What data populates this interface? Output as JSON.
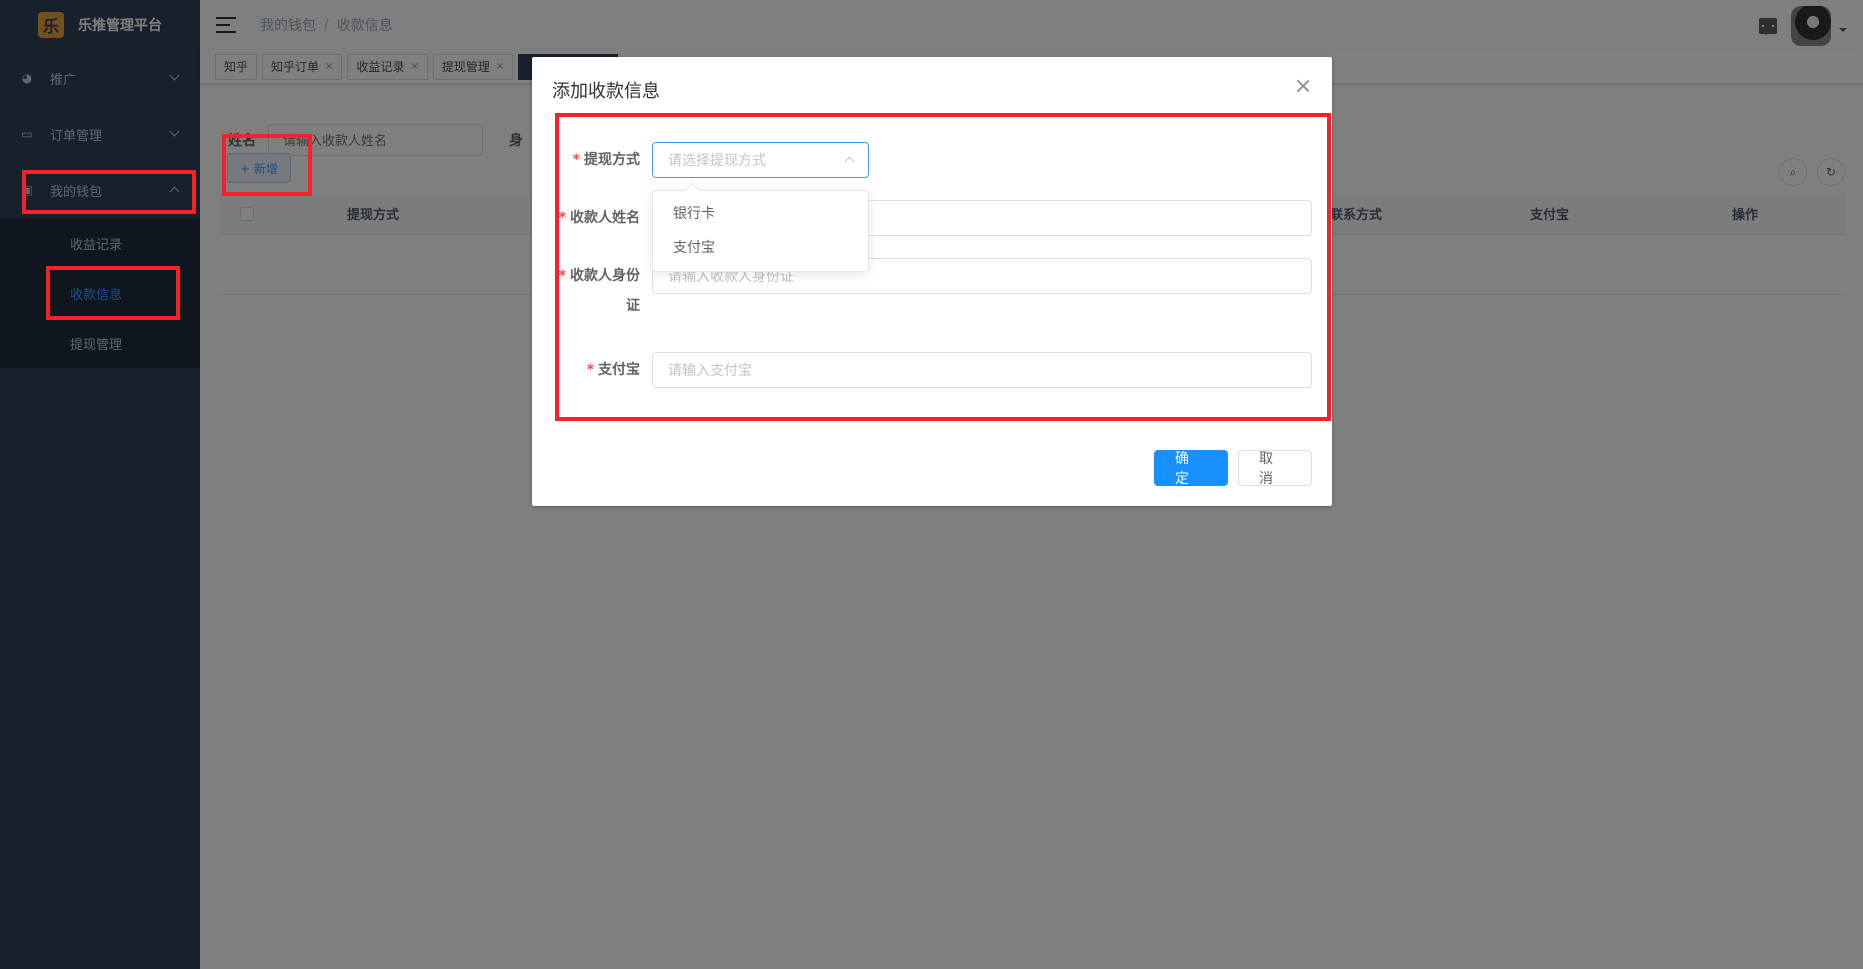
{
  "app": {
    "title": "乐推管理平台",
    "logo_glyph": "乐"
  },
  "sidebar": {
    "items": [
      {
        "label": "推广",
        "icon": "globe-icon"
      },
      {
        "label": "订单管理",
        "icon": "monitor-icon"
      },
      {
        "label": "我的钱包",
        "icon": "wallet-icon"
      }
    ],
    "submenu": [
      {
        "label": "收益记录"
      },
      {
        "label": "收款信息"
      },
      {
        "label": "提现管理"
      }
    ]
  },
  "navbar": {
    "breadcrumb": [
      "我的钱包",
      "收款信息"
    ],
    "separator": "/"
  },
  "tags": [
    {
      "label": "知乎",
      "closable": false
    },
    {
      "label": "知乎订单",
      "closable": true
    },
    {
      "label": "收益记录",
      "closable": true
    },
    {
      "label": "提现管理",
      "closable": true
    },
    {
      "label": "",
      "closable": false
    }
  ],
  "query": {
    "name_label": "姓名",
    "name_placeholder": "请输入收款人姓名",
    "second_label_partial": "身"
  },
  "toolbar": {
    "add_label": "+ 新增"
  },
  "table": {
    "columns": [
      "提现方式",
      "联系方式",
      "支付宝",
      "操作"
    ]
  },
  "dialog": {
    "title": "添加收款信息",
    "fields": {
      "method": {
        "label": "提现方式",
        "placeholder": "请选择提现方式"
      },
      "name": {
        "label": "收款人姓名",
        "placeholder": ""
      },
      "id": {
        "label_line1": "收款人身份",
        "label_line2": "证",
        "placeholder": "请输入收款人身份证"
      },
      "alipay": {
        "label": "支付宝",
        "placeholder": "请输入支付宝"
      }
    },
    "required_mark": "*",
    "dropdown_options": [
      "银行卡",
      "支付宝"
    ],
    "confirm_label": "确 定",
    "cancel_label": "取 消"
  },
  "colors": {
    "primary": "#1890ff",
    "sidebar_bg": "#304156",
    "annotation": "#f5222d"
  }
}
